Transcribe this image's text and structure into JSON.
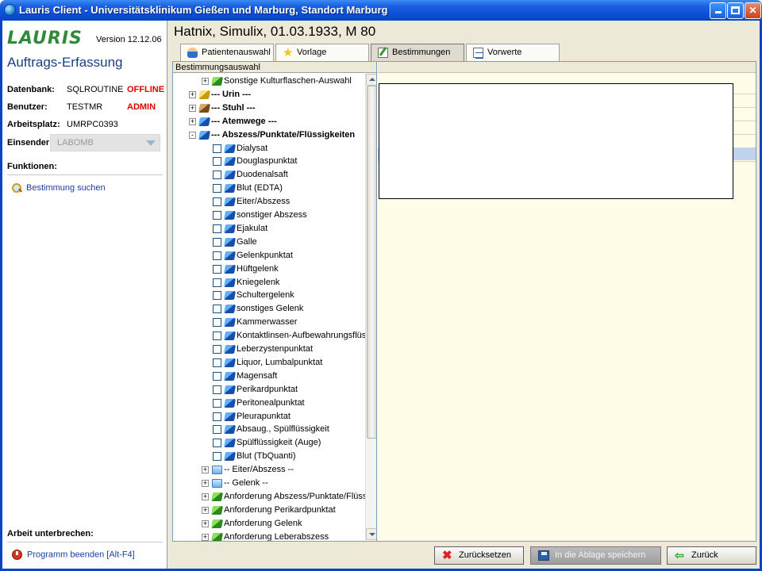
{
  "window": {
    "title": "Lauris Client - Universitätsklinikum Gießen und Marburg, Standort Marburg"
  },
  "sidebar": {
    "logo": "LAURIS",
    "version": "Version 12.12.06",
    "subtitle": "Auftrags-Erfassung",
    "info": [
      {
        "label": "Datenbank:",
        "value": "SQLROUTINE",
        "status": "OFFLINE"
      },
      {
        "label": "Benutzer:",
        "value": "TESTMR",
        "status": "ADMIN"
      },
      {
        "label": "Arbeitsplatz:",
        "value": "UMRPC0393",
        "status": ""
      }
    ],
    "sender_label": "Einsender:",
    "sender_value": "LABOMB",
    "functions_heading": "Funktionen:",
    "function_link": "Bestimmung suchen",
    "pause_heading": "Arbeit unterbrechen:",
    "exit_link": "Programm beenden [Alt-F4]"
  },
  "patient": {
    "header": "Hatnix, Simulix, 01.03.1933, M 80"
  },
  "tabs": [
    {
      "label": "Patientenauswahl",
      "icon": "person-icon"
    },
    {
      "label": "Vorlage",
      "icon": "star-icon"
    },
    {
      "label": "Bestimmungen",
      "icon": "edit-icon",
      "active": true
    },
    {
      "label": "Vorwerte",
      "icon": "document-icon"
    }
  ],
  "tree": {
    "header": "Bestimmungsauswahl",
    "items": [
      {
        "label": "Sonstige Kulturflaschen-Auswahl",
        "level": 2,
        "expander": "+",
        "icon": "green",
        "bold": false
      },
      {
        "label": "--- Urin ---",
        "level": 1,
        "expander": "+",
        "icon": "yellow",
        "bold": true
      },
      {
        "label": "--- Stuhl ---",
        "level": 1,
        "expander": "+",
        "icon": "brown",
        "bold": true
      },
      {
        "label": "--- Atemwege ---",
        "level": 1,
        "expander": "+",
        "icon": "blue",
        "bold": true
      },
      {
        "label": "--- Abszess/Punktate/Flüssigkeiten",
        "level": 1,
        "expander": "-",
        "icon": "blue",
        "bold": true
      },
      {
        "label": "Dialysat",
        "level": 3,
        "checkbox": true,
        "icon": "blue"
      },
      {
        "label": "Douglaspunktat",
        "level": 3,
        "checkbox": true,
        "icon": "blue"
      },
      {
        "label": "Duodenalsaft",
        "level": 3,
        "checkbox": true,
        "icon": "blue"
      },
      {
        "label": "Blut (EDTA)",
        "level": 3,
        "checkbox": true,
        "icon": "blue"
      },
      {
        "label": "Eiter/Abszess",
        "level": 3,
        "checkbox": true,
        "icon": "blue"
      },
      {
        "label": "sonstiger Abszess",
        "level": 3,
        "checkbox": true,
        "icon": "blue"
      },
      {
        "label": "Ejakulat",
        "level": 3,
        "checkbox": true,
        "icon": "blue"
      },
      {
        "label": "Galle",
        "level": 3,
        "checkbox": true,
        "icon": "blue"
      },
      {
        "label": "Gelenkpunktat",
        "level": 3,
        "checkbox": true,
        "icon": "blue"
      },
      {
        "label": "Hüftgelenk",
        "level": 3,
        "checkbox": true,
        "icon": "blue"
      },
      {
        "label": "Kniegelenk",
        "level": 3,
        "checkbox": true,
        "icon": "blue"
      },
      {
        "label": "Schultergelenk",
        "level": 3,
        "checkbox": true,
        "icon": "blue"
      },
      {
        "label": "sonstiges Gelenk",
        "level": 3,
        "checkbox": true,
        "icon": "blue"
      },
      {
        "label": "Kammerwasser",
        "level": 3,
        "checkbox": true,
        "icon": "blue"
      },
      {
        "label": "Kontaktlinsen-Aufbewahrungsflüssi",
        "level": 3,
        "checkbox": true,
        "icon": "blue"
      },
      {
        "label": "Leberzystenpunktat",
        "level": 3,
        "checkbox": true,
        "icon": "blue"
      },
      {
        "label": "Liquor, Lumbalpunktat",
        "level": 3,
        "checkbox": true,
        "icon": "blue"
      },
      {
        "label": "Magensaft",
        "level": 3,
        "checkbox": true,
        "icon": "blue"
      },
      {
        "label": "Perikardpunktat",
        "level": 3,
        "checkbox": true,
        "icon": "blue"
      },
      {
        "label": "Peritonealpunktat",
        "level": 3,
        "checkbox": true,
        "icon": "blue"
      },
      {
        "label": "Pleurapunktat",
        "level": 3,
        "checkbox": true,
        "icon": "blue"
      },
      {
        "label": "Absaug., Spülflüssigkeit",
        "level": 3,
        "checkbox": true,
        "icon": "blue"
      },
      {
        "label": "Spülflüssigkeit (Auge)",
        "level": 3,
        "checkbox": true,
        "icon": "blue"
      },
      {
        "label": "Blut (TbQuanti)",
        "level": 3,
        "checkbox": true,
        "icon": "blue"
      },
      {
        "label": "-- Eiter/Abszess --",
        "level": 2,
        "expander": "+",
        "icon": "folder"
      },
      {
        "label": "-- Gelenk --",
        "level": 2,
        "expander": "+",
        "icon": "folder"
      },
      {
        "label": "Anforderung Abszess/Punktate/Flüssig",
        "level": 2,
        "expander": "+",
        "icon": "green"
      },
      {
        "label": "Anforderung Perikardpunktat",
        "level": 2,
        "expander": "+",
        "icon": "green"
      },
      {
        "label": "Anforderung Gelenk",
        "level": 2,
        "expander": "+",
        "icon": "green"
      },
      {
        "label": "Anforderung Leberabszess",
        "level": 2,
        "expander": "+",
        "icon": "green"
      }
    ]
  },
  "buttons": {
    "reset": "Zurücksetzen",
    "save": "In die Ablage speichern",
    "back": "Zurück"
  },
  "colors": {
    "titlebar": "#0b4fd6",
    "status_red": "#e00000",
    "link_blue": "#1b3ea8",
    "selection": "#c1d2ee"
  }
}
